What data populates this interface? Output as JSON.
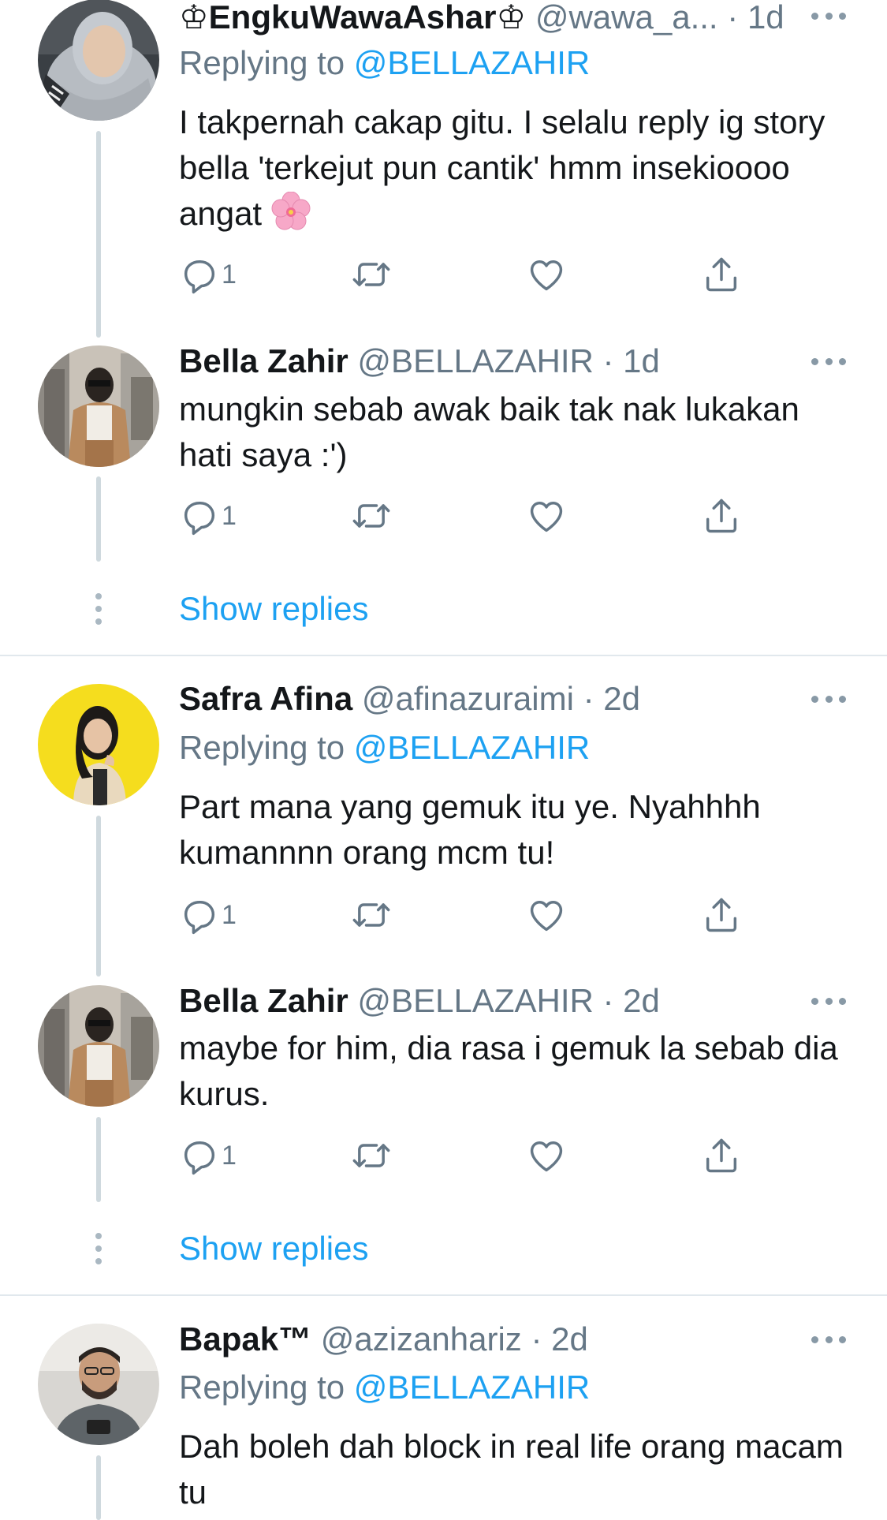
{
  "tweets": [
    {
      "name": "♔EngkuWawaAshar♔",
      "handle": "@wawa_a...",
      "dot": "·",
      "time": "1d",
      "replying_prefix": "Replying to",
      "replying_to": "@BELLAZAHIR",
      "text": "I takpernah cakap gitu. I selalu reply ig story bella 'terkejut pun cantik' hmm insekioooo angat",
      "emoji": "cherry-blossom",
      "reply_count": "1"
    },
    {
      "name": "Bella Zahir",
      "handle": "@BELLAZAHIR",
      "dot": "·",
      "time": "1d",
      "text": "mungkin sebab awak baik tak nak lukakan hati saya :')",
      "reply_count": "1"
    },
    {
      "name": "Safra Afina",
      "handle": "@afinazuraimi",
      "dot": "·",
      "time": "2d",
      "replying_prefix": "Replying to",
      "replying_to": "@BELLAZAHIR",
      "text": "Part mana yang gemuk itu ye. Nyahhhh kumannnn orang mcm tu!",
      "reply_count": "1"
    },
    {
      "name": "Bella Zahir",
      "handle": "@BELLAZAHIR",
      "dot": "·",
      "time": "2d",
      "text": "maybe for him, dia rasa i gemuk la sebab dia kurus.",
      "reply_count": "1"
    },
    {
      "name": "Bapak™",
      "handle": "@azizanhariz",
      "dot": "·",
      "time": "2d",
      "replying_prefix": "Replying to",
      "replying_to": "@BELLAZAHIR",
      "text": "Dah boleh dah block in real life orang macam tu"
    }
  ],
  "show_replies_label": "Show replies",
  "icons": {
    "reply": "reply-icon",
    "retweet": "retweet-icon",
    "like": "like-icon",
    "share": "share-icon",
    "more": "more-icon"
  },
  "colors": {
    "link": "#1da1f2",
    "secondary_text": "#657786",
    "icon": "#657786",
    "thread_line": "#cfd9de"
  }
}
